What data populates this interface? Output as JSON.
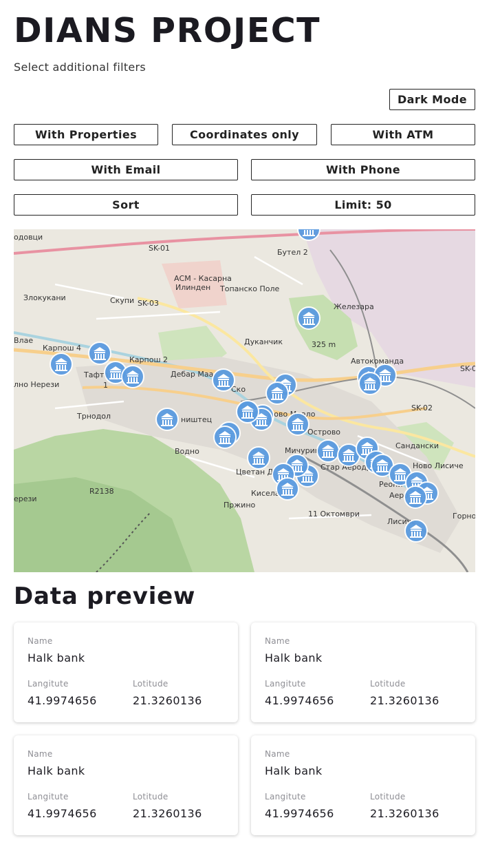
{
  "header": {
    "title": "DIANS PROJECT",
    "subtitle": "Select additional filters"
  },
  "filters": {
    "dark_mode": "Dark Mode",
    "with_properties": "With Properties",
    "coordinates_only": "Coordinates only",
    "with_atm": "With ATM",
    "with_email": "With Email",
    "with_phone": "With Phone",
    "sort": "Sort",
    "limit": "Limit: 50"
  },
  "map": {
    "marker_icon": "bank-icon",
    "marker_color": "#5b9be0",
    "labels": [
      "SK-01",
      "Бутел 2",
      "АСМ - Касарна",
      "Илинден",
      "Топанско Поле",
      "Злокукани",
      "Скупи",
      "SK-03",
      "Железара",
      "Влае",
      "Карпош 4",
      "325 m",
      "Дуканчик",
      "Автокоманда",
      "Карпош 2",
      "SK-0",
      "Тафта",
      "1",
      "Дебар Маа",
      "лно Нерези",
      "Трнодол",
      "ништец",
      "Ново Маало",
      "SK-02",
      "Острово",
      "Водно",
      "Мичурин",
      "Сандански",
      "Цветан Д",
      "Стар Аеродр",
      "Ново Лисиче",
      "ерези",
      "R2138",
      "Кисела",
      "Реони",
      "Аеро",
      "Пржино",
      "11 Октомври",
      "Горно",
      "Лисиче",
      "одовци",
      "Ско"
    ]
  },
  "data_preview": {
    "title": "Data preview",
    "name_label": "Name",
    "lng_label": "Langitute",
    "lat_label": "Lotitude",
    "cards": [
      {
        "name": "Halk bank",
        "lng": "41.9974656",
        "lat": "21.3260136"
      },
      {
        "name": "Halk bank",
        "lng": "41.9974656",
        "lat": "21.3260136"
      },
      {
        "name": "Halk bank",
        "lng": "41.9974656",
        "lat": "21.3260136"
      },
      {
        "name": "Halk bank",
        "lng": "41.9974656",
        "lat": "21.3260136"
      }
    ]
  }
}
